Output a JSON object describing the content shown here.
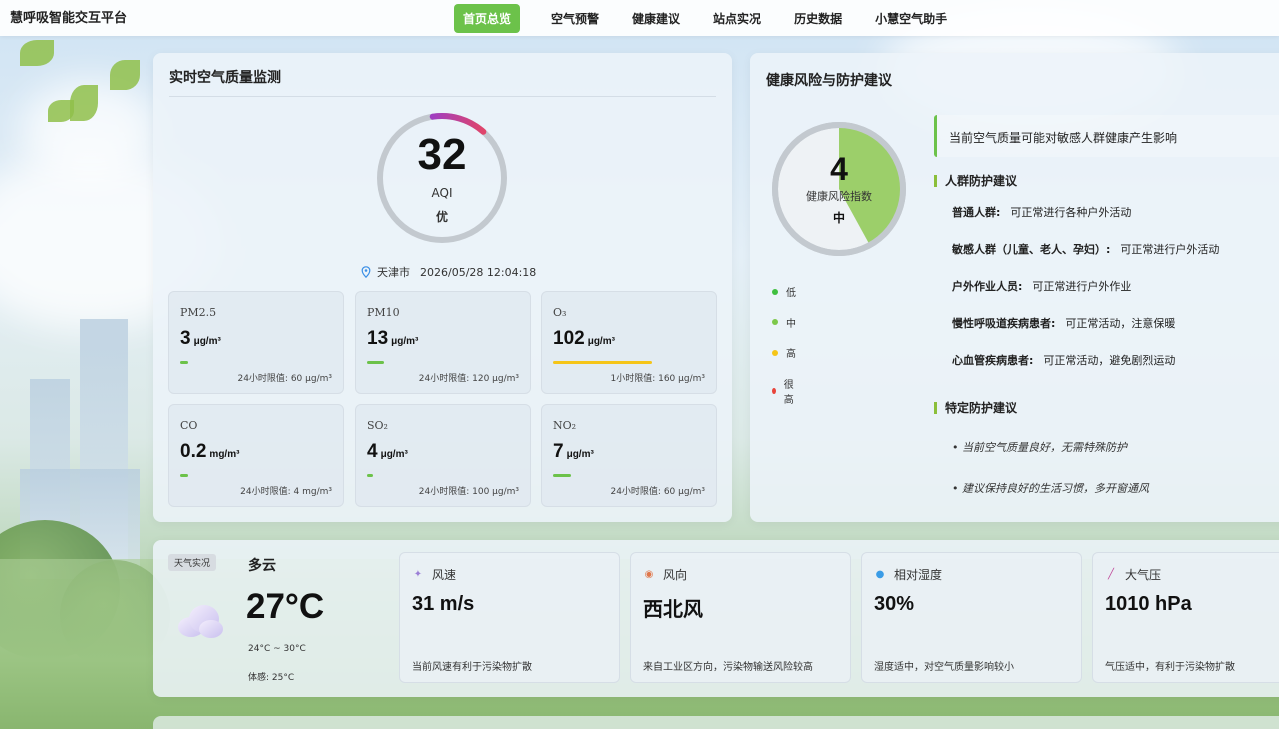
{
  "nav": {
    "brand": "慧呼吸智能交互平台",
    "items": [
      {
        "label": "首页总览",
        "active": true
      },
      {
        "label": "空气预警",
        "active": false
      },
      {
        "label": "健康建议",
        "active": false
      },
      {
        "label": "站点实况",
        "active": false
      },
      {
        "label": "历史数据",
        "active": false
      },
      {
        "label": "小慧空气助手",
        "active": false
      }
    ]
  },
  "air_quality": {
    "title": "实时空气质量监测",
    "aqi": {
      "value": "32",
      "label": "AQI",
      "level": "优",
      "gauge_fraction": 0.14
    },
    "location": {
      "city": "天津市",
      "time": "2026/05/28 12:04:18"
    },
    "pollutants": [
      {
        "name": "PM2.5",
        "value": "3",
        "unit": "μg/m³",
        "limit": "24小时限值: 60 μg/m³",
        "level_fraction": 0.05,
        "bar_color": "#6cc24a"
      },
      {
        "name": "PM10",
        "value": "13",
        "unit": "μg/m³",
        "limit": "24小时限值: 120 μg/m³",
        "level_fraction": 0.11,
        "bar_color": "#6cc24a"
      },
      {
        "name": "O₃",
        "value": "102",
        "unit": "μg/m³",
        "limit": "1小时限值: 160 μg/m³",
        "level_fraction": 0.64,
        "bar_color": "#f5c518"
      },
      {
        "name": "CO",
        "value": "0.2",
        "unit": "mg/m³",
        "limit": "24小时限值: 4 mg/m³",
        "level_fraction": 0.05,
        "bar_color": "#6cc24a"
      },
      {
        "name": "SO₂",
        "value": "4",
        "unit": "μg/m³",
        "limit": "24小时限值: 100 μg/m³",
        "level_fraction": 0.04,
        "bar_color": "#6cc24a"
      },
      {
        "name": "NO₂",
        "value": "7",
        "unit": "μg/m³",
        "limit": "24小时限值: 60 μg/m³",
        "level_fraction": 0.12,
        "bar_color": "#6cc24a"
      }
    ]
  },
  "health": {
    "title": "健康风险与防护建议",
    "risk": {
      "value": "4",
      "label": "健康风险指数",
      "level": "中",
      "fill_fraction": 0.42
    },
    "legend": [
      {
        "label": "低",
        "color": "#3fbf3f"
      },
      {
        "label": "中",
        "color": "#7cc84a"
      },
      {
        "label": "高",
        "color": "#f5c518"
      },
      {
        "label": "很高",
        "color": "#e8443a"
      }
    ],
    "notice": "当前空气质量可能对敏感人群健康产生影响",
    "group_title": "人群防护建议",
    "groups": [
      {
        "who": "普通人群:",
        "advice": "可正常进行各种户外活动"
      },
      {
        "who": "敏感人群（儿童、老人、孕妇）:",
        "advice": "可正常进行户外活动"
      },
      {
        "who": "户外作业人员:",
        "advice": "可正常进行户外作业"
      },
      {
        "who": "慢性呼吸道疾病患者:",
        "advice": "可正常活动，注意保暖"
      },
      {
        "who": "心血管疾病患者:",
        "advice": "可正常活动，避免剧烈运动"
      }
    ],
    "special_title": "特定防护建议",
    "special_tips": [
      "• 当前空气质量良好，无需特殊防护",
      "• 建议保持良好的生活习惯，多开窗通风"
    ]
  },
  "weather": {
    "badge": "天气实况",
    "condition": "多云",
    "temperature": "27°C",
    "range": "24°C ~ 30°C",
    "feels_like": "体感: 25°C",
    "cards": [
      {
        "label": "风速",
        "value": "31 m/s",
        "note": "当前风速有利于污染物扩散",
        "icon": "wind-icon"
      },
      {
        "label": "风向",
        "value": "西北风",
        "note": "来自工业区方向，污染物输送风险较高",
        "icon": "compass-icon"
      },
      {
        "label": "相对湿度",
        "value": "30%",
        "note": "湿度适中，对空气质量影响较小",
        "icon": "droplet-icon"
      },
      {
        "label": "大气压",
        "value": "1010 hPa",
        "note": "气压适中，有利于污染物扩散",
        "icon": "thermometer-icon"
      }
    ]
  }
}
